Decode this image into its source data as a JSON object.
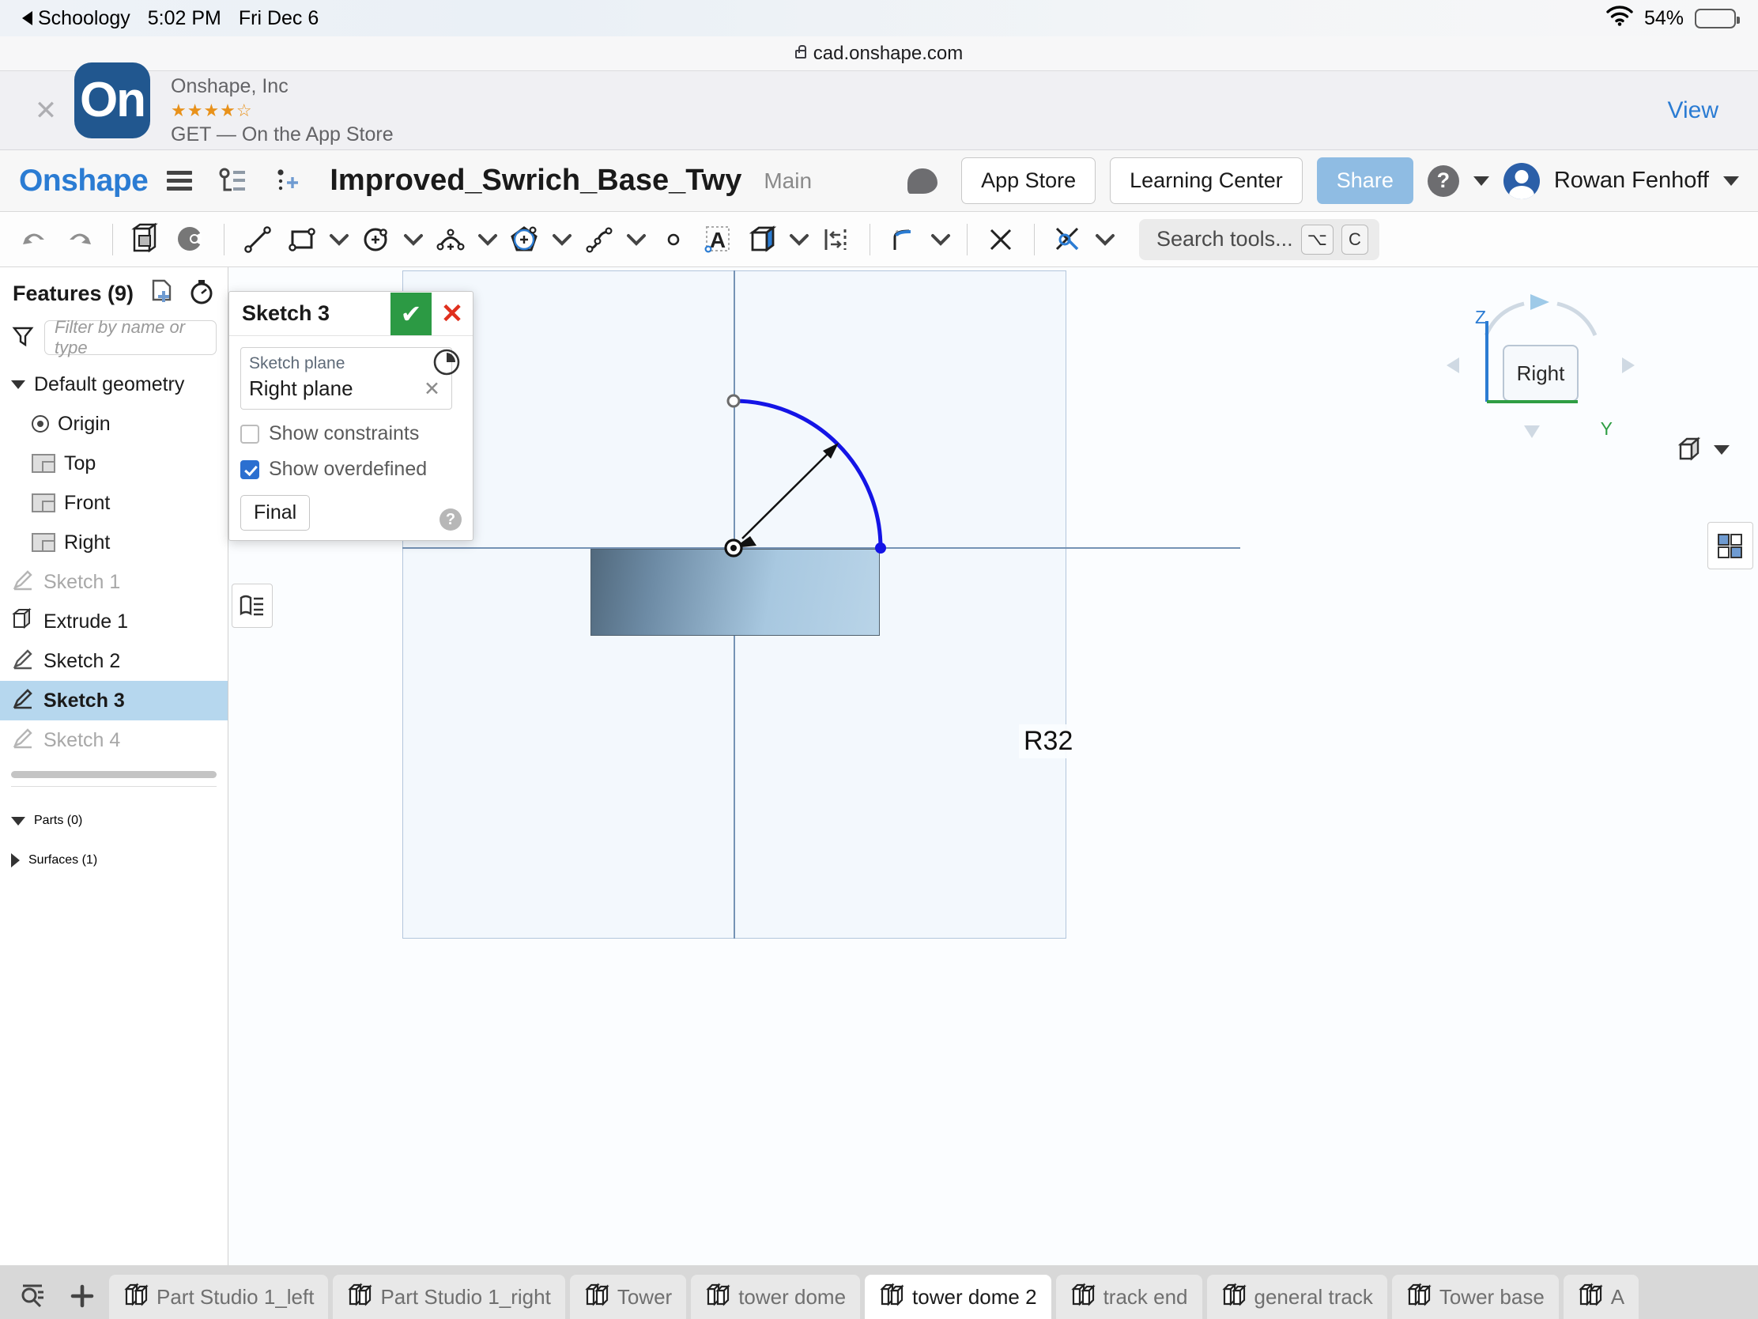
{
  "status_bar": {
    "back_app": "Schoology",
    "time": "5:02 PM",
    "date": "Fri Dec 6",
    "battery_percent": "54%",
    "wifi_icon": "wifi-icon",
    "battery_icon": "battery-icon"
  },
  "browser": {
    "url": "cad.onshape.com",
    "lock_icon": "lock-icon"
  },
  "smart_banner": {
    "close_icon": "close-icon",
    "app_icon_text": "On",
    "developer": "Onshape, Inc",
    "stars": "★★★★☆",
    "rating_value": 3.5,
    "cta": "GET — On the App Store",
    "view_label": "View"
  },
  "header": {
    "logo": "Onshape",
    "menu_icon": "hamburger-icon",
    "versions_icon": "version-graph-icon",
    "insert_icon": "add-feature-icon",
    "document_title": "Improved_Swrich_Base_Twy",
    "workspace": "Main",
    "comment_icon": "comment-icon",
    "app_store_label": "App Store",
    "learning_center_label": "Learning Center",
    "share_label": "Share",
    "help_icon": "help-icon",
    "user_name": "Rowan Fenhoff",
    "accent_blue": "#2b7cd3",
    "share_bg": "#8fbce3"
  },
  "toolbar": {
    "items": [
      {
        "icon": "undo-icon",
        "name": "undo"
      },
      {
        "icon": "redo-icon",
        "name": "redo"
      },
      {
        "icon": "sketch-cube-icon",
        "name": "new-sketch"
      },
      {
        "icon": "sketch-dim-icon",
        "name": "dimension-tool"
      },
      {
        "icon": "line-icon",
        "name": "line-tool"
      },
      {
        "icon": "rectangle-icon",
        "name": "rectangle-tool"
      },
      {
        "icon": "chevron-down-icon",
        "name": "rectangle-dropdown"
      },
      {
        "icon": "circle-icon",
        "name": "circle-tool"
      },
      {
        "icon": "chevron-down-icon",
        "name": "circle-dropdown"
      },
      {
        "icon": "arc-icon",
        "name": "arc-tool"
      },
      {
        "icon": "chevron-down-icon",
        "name": "arc-dropdown"
      },
      {
        "icon": "polygon-icon",
        "name": "polygon-tool"
      },
      {
        "icon": "chevron-down-icon",
        "name": "polygon-dropdown"
      },
      {
        "icon": "spline-icon",
        "name": "spline-tool"
      },
      {
        "icon": "chevron-down-icon",
        "name": "spline-dropdown"
      },
      {
        "icon": "point-icon",
        "name": "point-tool"
      },
      {
        "icon": "text-icon",
        "name": "text-tool"
      },
      {
        "icon": "use-projection-icon",
        "name": "use-tool"
      },
      {
        "icon": "chevron-down-icon",
        "name": "use-dropdown"
      },
      {
        "icon": "mirror-icon",
        "name": "mirror-tool"
      },
      {
        "icon": "fillet-icon",
        "name": "fillet-tool"
      },
      {
        "icon": "chevron-down-icon",
        "name": "fillet-dropdown"
      },
      {
        "icon": "trim-icon",
        "name": "trim-tool"
      },
      {
        "icon": "constraint-icon",
        "name": "constraints-tool"
      },
      {
        "icon": "chevron-down-icon",
        "name": "constraints-dropdown"
      }
    ],
    "search_placeholder": "Search tools...",
    "search_keys": [
      "⌥",
      "C"
    ]
  },
  "features_panel": {
    "title": "Features (9)",
    "add_icon": "add-feature-icon",
    "history_icon": "history-icon",
    "filter_icon": "filter-icon",
    "filter_placeholder": "Filter by name or type",
    "tree": [
      {
        "label": "Default geometry",
        "icon": "chevron-down-icon",
        "level": 0,
        "state": "normal"
      },
      {
        "label": "Origin",
        "icon": "origin-icon",
        "level": 1,
        "state": "normal"
      },
      {
        "label": "Top",
        "icon": "plane-icon",
        "level": 1,
        "state": "normal"
      },
      {
        "label": "Front",
        "icon": "plane-icon",
        "level": 1,
        "state": "normal"
      },
      {
        "label": "Right",
        "icon": "plane-icon",
        "level": 1,
        "state": "normal"
      },
      {
        "label": "Sketch 1",
        "icon": "sketch-icon",
        "level": 0,
        "state": "dim"
      },
      {
        "label": "Extrude 1",
        "icon": "extrude-icon",
        "level": 0,
        "state": "normal"
      },
      {
        "label": "Sketch 2",
        "icon": "sketch-icon",
        "level": 0,
        "state": "normal"
      },
      {
        "label": "Sketch 3",
        "icon": "sketch-icon",
        "level": 0,
        "state": "selected"
      },
      {
        "label": "Sketch 4",
        "icon": "sketch-icon",
        "level": 0,
        "state": "dim"
      }
    ],
    "parts_label": "Parts (0)",
    "surfaces_label": "Surfaces (1)",
    "selection_color": "#b6d7ee"
  },
  "sketch_dialog": {
    "title": "Sketch 3",
    "accept_icon": "checkmark-icon",
    "cancel_icon": "close-icon",
    "clock_icon": "history-clock-icon",
    "plane_field_label": "Sketch plane",
    "plane_field_value": "Right plane",
    "plane_clear_icon": "clear-icon",
    "show_constraints_label": "Show constraints",
    "show_constraints_checked": false,
    "show_overdefined_label": "Show overdefined",
    "show_overdefined_checked": true,
    "final_button_label": "Final",
    "help_icon": "help-icon",
    "accept_color": "#2c9a44",
    "cancel_color": "#e0301e"
  },
  "canvas": {
    "dimension_label": "R32",
    "dimension_radius": 32,
    "view_cube_face": "Right",
    "axis_z_label": "Z",
    "axis_y_label": "Y",
    "sketch_color": "#1414e6",
    "plane_outline_color": "#b3c6dc",
    "display_icon": "display-options-icon",
    "list_icon": "feature-list-icon",
    "view_cube_icon": "view-cube-icon"
  },
  "tab_bar": {
    "search_icon": "tab-search-icon",
    "add_icon": "plus-icon",
    "tabs": [
      {
        "label": "Part Studio 1_left",
        "active": false
      },
      {
        "label": "Part Studio 1_right",
        "active": false
      },
      {
        "label": "Tower",
        "active": false
      },
      {
        "label": "tower dome",
        "active": false
      },
      {
        "label": "tower dome 2",
        "active": true
      },
      {
        "label": "track end",
        "active": false
      },
      {
        "label": "general track",
        "active": false
      },
      {
        "label": "Tower base",
        "active": false
      },
      {
        "label": "A",
        "active": false
      }
    ]
  }
}
